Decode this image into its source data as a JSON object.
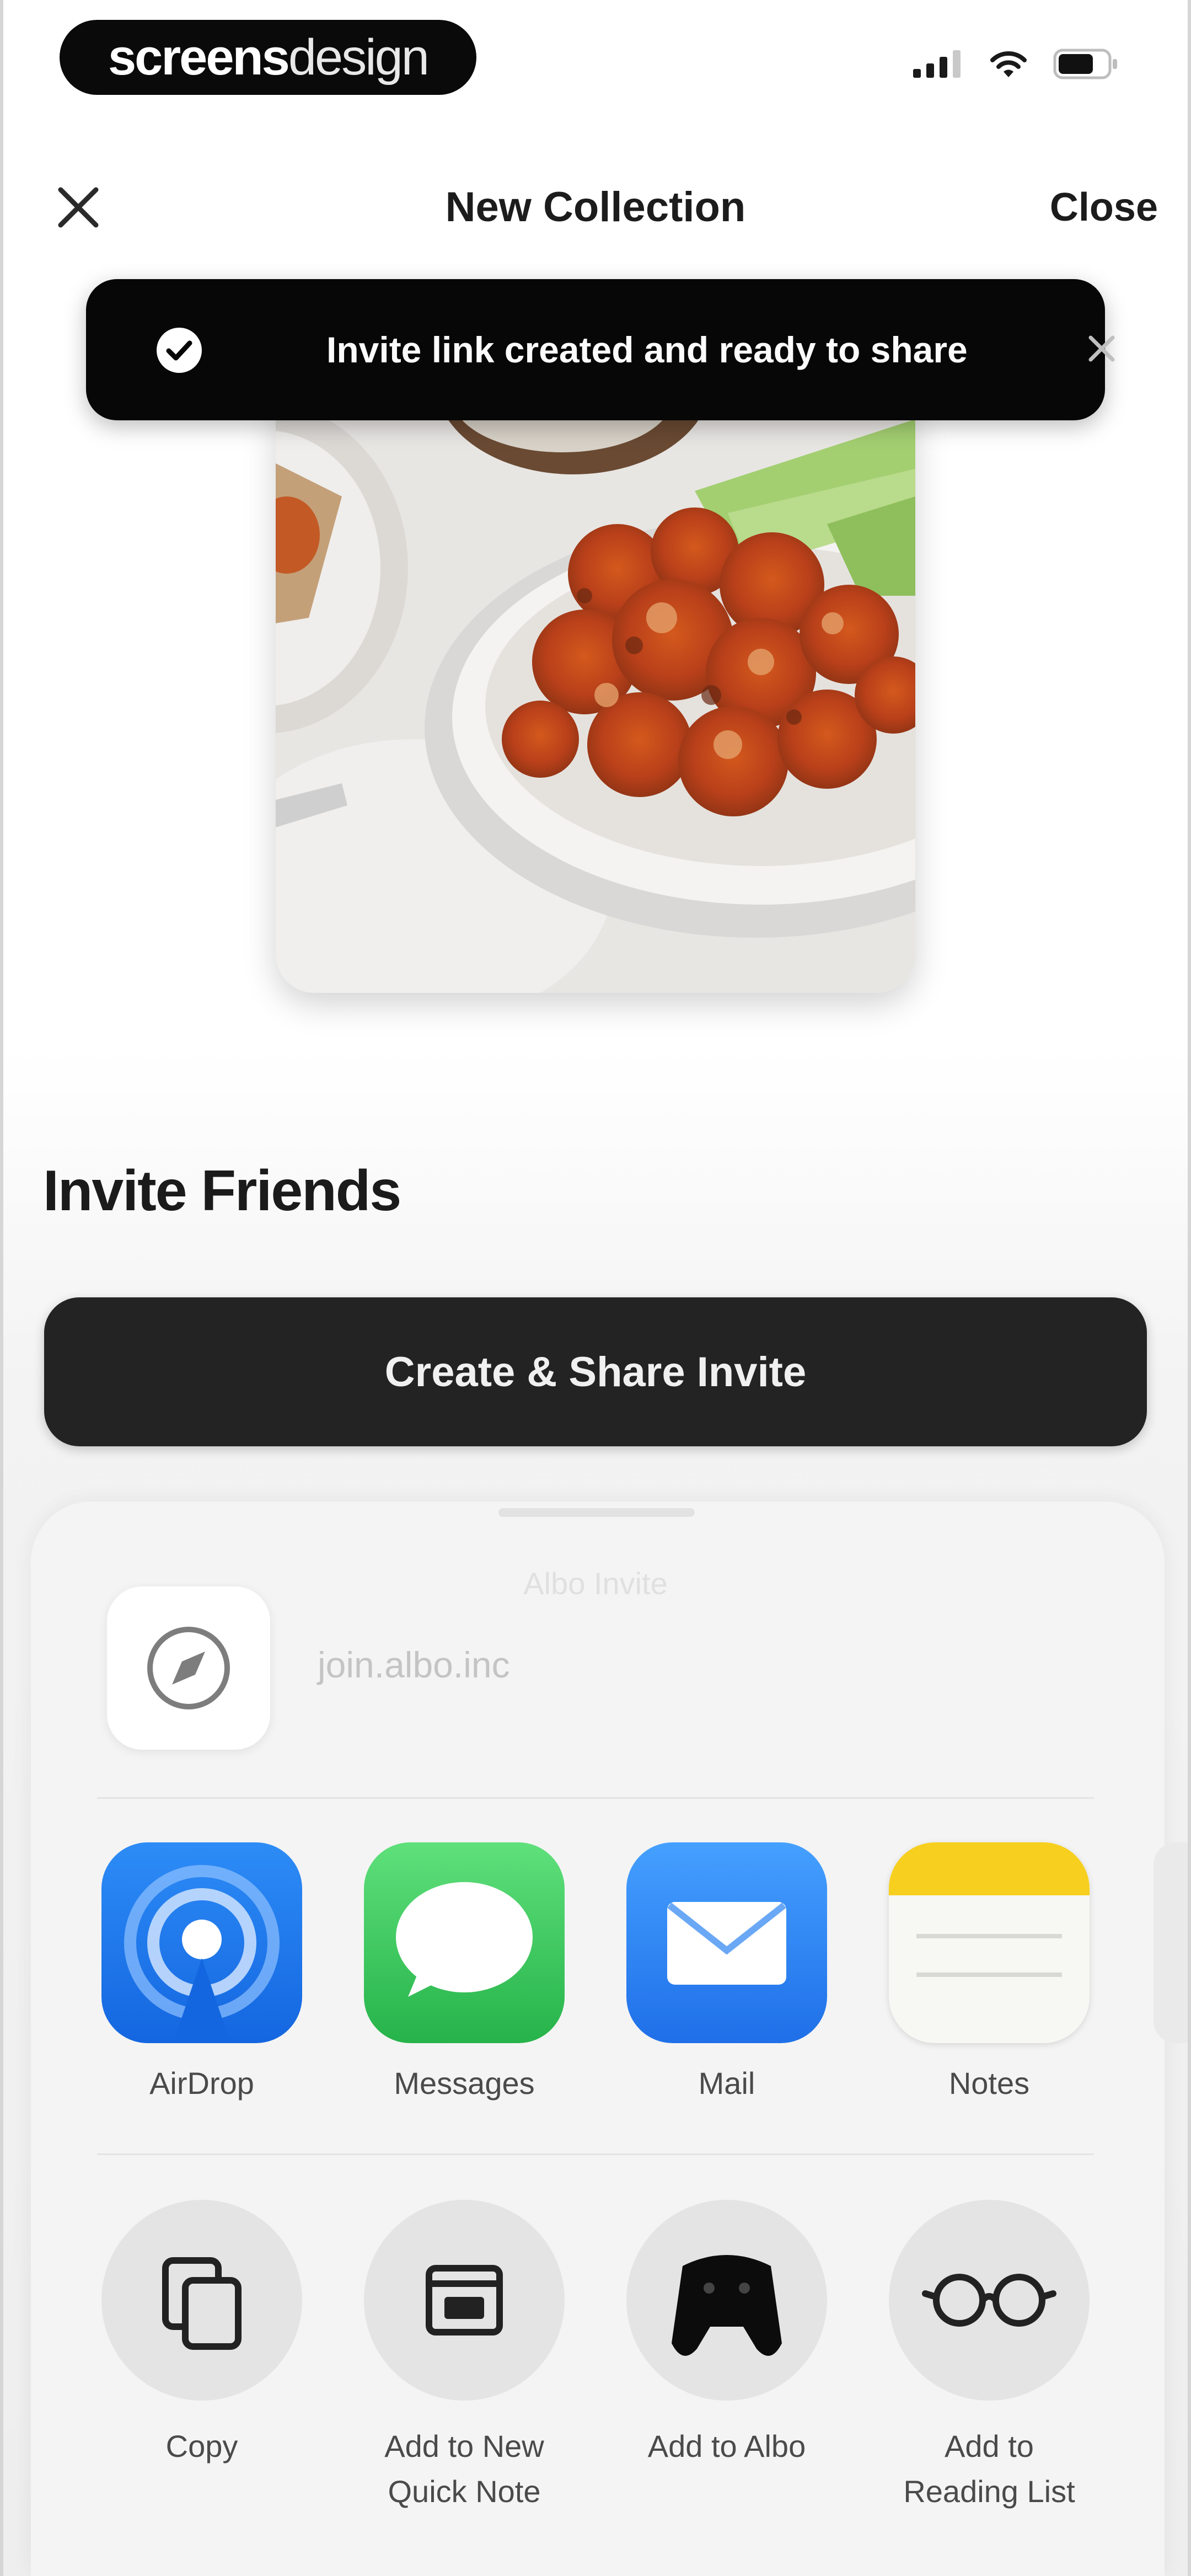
{
  "status_bar": {
    "brand_bold": "screens",
    "brand_light": "design",
    "icons": [
      "cellular-signal-icon",
      "wifi-icon",
      "battery-icon"
    ]
  },
  "nav": {
    "close_icon": "close-icon",
    "title": "New Collection",
    "close_label": "Close"
  },
  "toast": {
    "icon": "checkmark-circle-icon",
    "message": "Invite link created and ready to share",
    "dismiss_icon": "close-icon"
  },
  "collection_image": {
    "description": "bowl of buffalo cauliflower with celery sticks and dip"
  },
  "invite": {
    "title": "Invite Friends",
    "button_label": "Create & Share Invite"
  },
  "share_sheet": {
    "subtitle": "Albo Invite",
    "link_icon": "compass-icon",
    "link_text": "join.albo.inc",
    "apps": [
      {
        "label": "AirDrop",
        "icon": "airdrop-icon",
        "color": "#1f7df3"
      },
      {
        "label": "Messages",
        "icon": "messages-icon",
        "color": "#36c759"
      },
      {
        "label": "Mail",
        "icon": "mail-icon",
        "color": "#2f86f5"
      },
      {
        "label": "Notes",
        "icon": "notes-icon",
        "color": "#f7d21c"
      }
    ],
    "actions": [
      {
        "label_line1": "Copy",
        "label_line2": "",
        "icon": "copy-icon"
      },
      {
        "label_line1": "Add to New",
        "label_line2": "Quick Note",
        "icon": "quick-note-icon"
      },
      {
        "label_line1": "Add to Albo",
        "label_line2": "",
        "icon": "albo-icon"
      },
      {
        "label_line1": "Add to",
        "label_line2": "Reading List",
        "icon": "reading-list-icon"
      }
    ]
  },
  "colors": {
    "toast_bg": "#070707",
    "cta_bg": "#232323",
    "sheet_bg": "#f4f4f4"
  }
}
